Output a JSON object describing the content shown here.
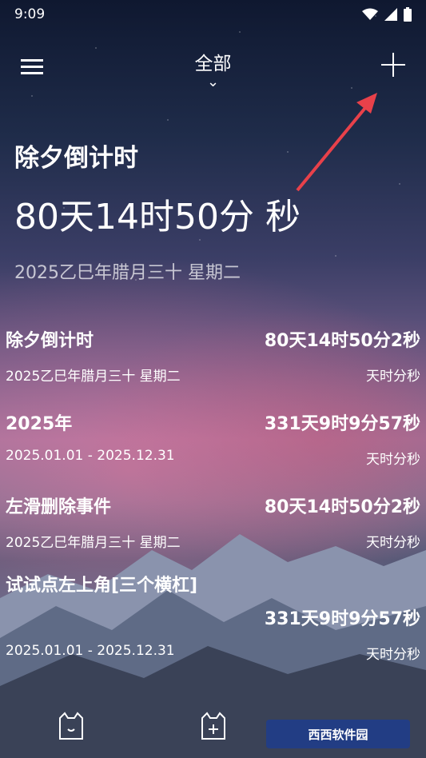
{
  "status_bar": {
    "time": "9:09"
  },
  "header": {
    "filter_label": "全部"
  },
  "hero": {
    "title": "除夕倒计时",
    "countdown": "80天14时50分  秒",
    "date": "2025乙巳年腊月三十 星期二"
  },
  "events": [
    {
      "name": "除夕倒计时",
      "count": "80天14时50分2秒",
      "date": "2025乙巳年腊月三十 星期二",
      "unit": "天时分秒"
    },
    {
      "name": "2025年",
      "count": "331天9时9分57秒",
      "date": "2025.01.01 - 2025.12.31",
      "unit": "天时分秒"
    },
    {
      "name": "左滑删除事件",
      "count": "80天14时50分2秒",
      "date": "2025乙巳年腊月三十 星期二",
      "unit": "天时分秒"
    },
    {
      "name": "试试点左上角[三个横杠]",
      "count": "331天9时9分57秒",
      "date": "2025.01.01 - 2025.12.31",
      "unit": "天时分秒"
    }
  ],
  "watermark": {
    "text": "西西软件园"
  },
  "colors": {
    "arrow": "#e8414a"
  }
}
